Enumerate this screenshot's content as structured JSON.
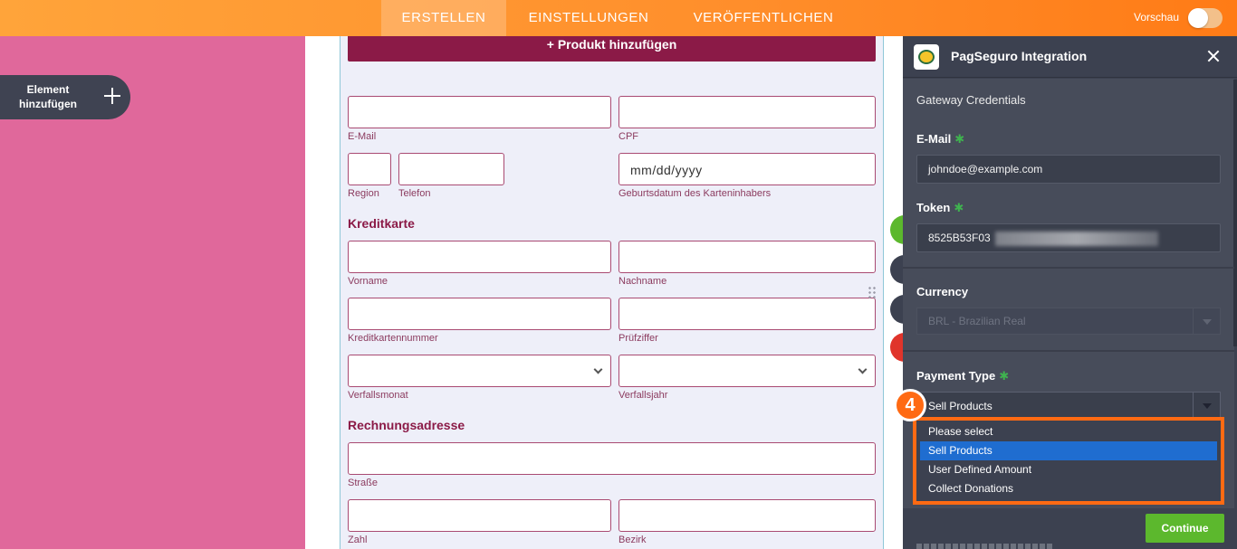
{
  "topbar": {
    "tabs": [
      "ERSTELLEN",
      "EINSTELLUNGEN",
      "VERÖFFENTLICHEN"
    ],
    "active_tab": "ERSTELLEN",
    "preview_label": "Vorschau",
    "preview_enabled": false
  },
  "sidebar": {
    "add_element_label": "Element hinzufügen"
  },
  "form": {
    "add_product_label": "+ Produkt hinzufügen",
    "fields": {
      "email": "E-Mail",
      "cpf": "CPF",
      "region": "Region",
      "phone": "Telefon",
      "birthdate": "Geburtsdatum des Karteninhabers",
      "birthdate_placeholder": "mm/dd/yyyy",
      "firstname": "Vorname",
      "lastname": "Nachname",
      "card_number": "Kreditkartennummer",
      "cvv": "Prüfziffer",
      "exp_month": "Verfallsmonat",
      "exp_year": "Verfallsjahr",
      "street": "Straße",
      "number": "Zahl",
      "district": "Bezirk"
    },
    "sections": {
      "credit_card": "Kreditkarte",
      "billing_address": "Rechnungsadresse"
    }
  },
  "panel": {
    "title": "PagSeguro Integration",
    "gateway_heading": "Gateway Credentials",
    "email_label": "E-Mail",
    "email_value": "johndoe@example.com",
    "token_label": "Token",
    "token_value": "8525B53F03",
    "currency_label": "Currency",
    "currency_value": "BRL - Brazilian Real",
    "payment_type_label": "Payment Type",
    "payment_type_value": "Sell Products",
    "payment_options": [
      "Please select",
      "Sell Products",
      "User Defined Amount",
      "Collect Donations"
    ],
    "selected_option_index": 1,
    "continue_label": "Continue"
  },
  "annotation": {
    "step_number": "4",
    "highlight_color": "#ff6a13"
  },
  "colors": {
    "topbar_orange": "#ff8e2b",
    "left_pink": "#e0689b",
    "form_accent": "#8b1a47",
    "panel_bg": "#3c4150",
    "continue_green": "#5cb82d",
    "selected_blue": "#1f6dd0"
  }
}
